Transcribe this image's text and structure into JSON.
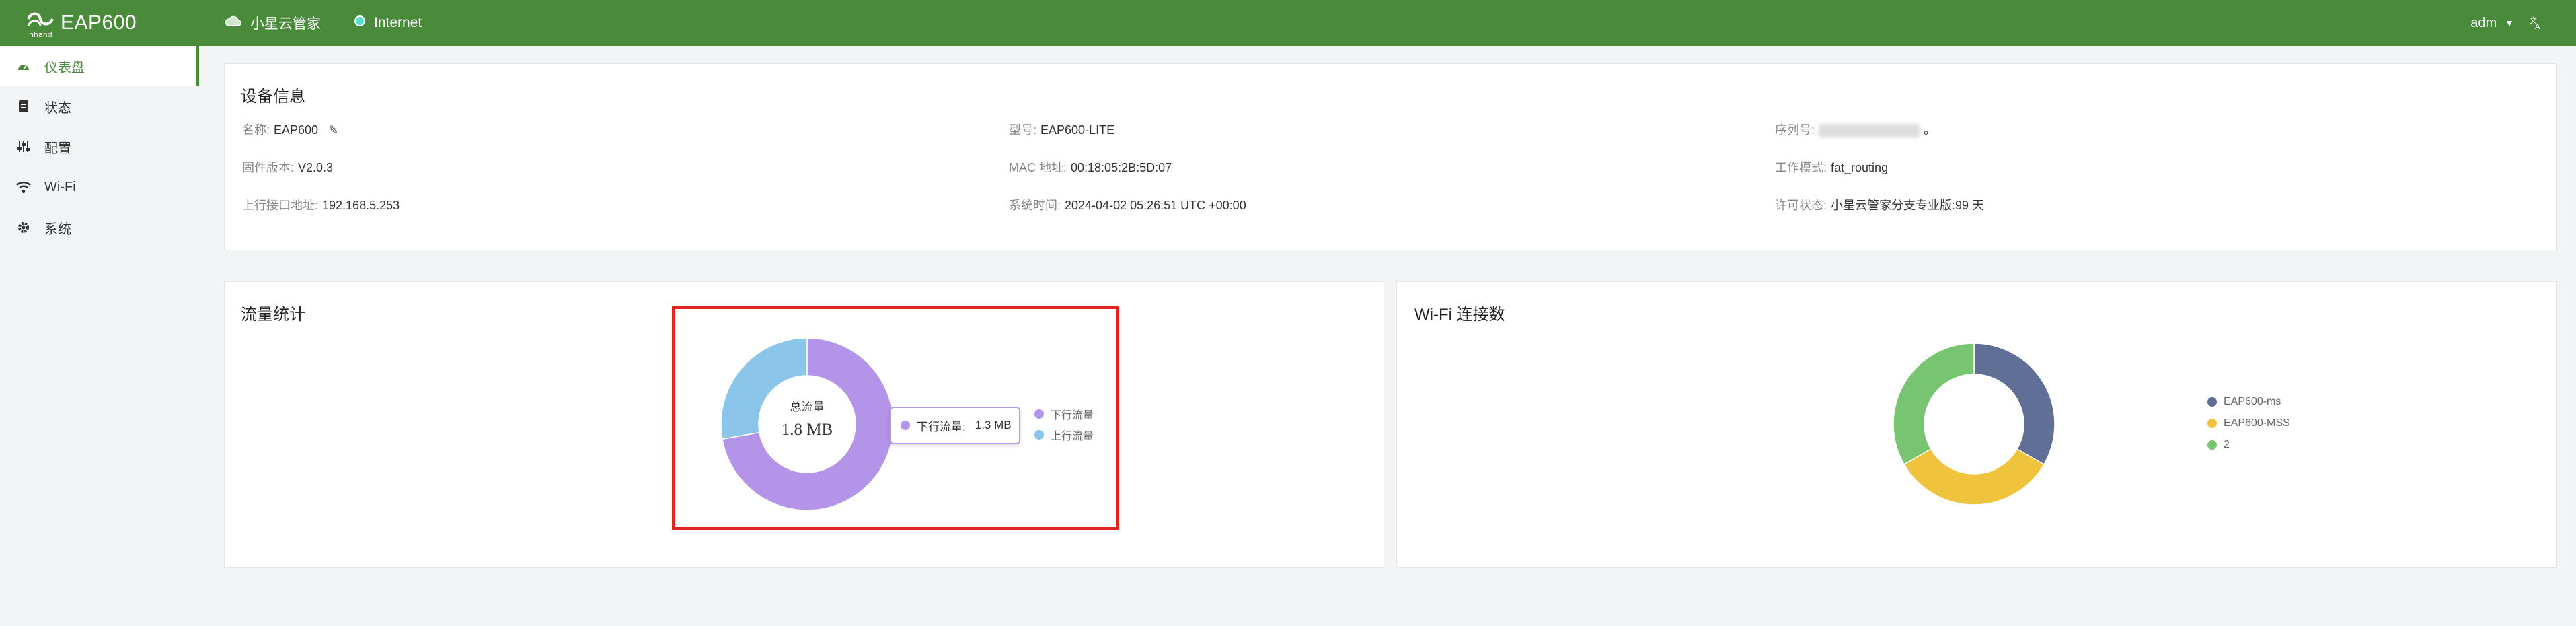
{
  "app": {
    "logo_sub": "inhand",
    "title": "EAP600"
  },
  "topbar": {
    "cloud_label": "小星云管家",
    "internet_label": "Internet",
    "user": "adm"
  },
  "sidebar": {
    "items": [
      {
        "label": "仪表盘",
        "icon": "dashboard-icon",
        "active": true
      },
      {
        "label": "状态",
        "icon": "status-icon"
      },
      {
        "label": "配置",
        "icon": "config-icon"
      },
      {
        "label": "Wi-Fi",
        "icon": "wifi-icon"
      },
      {
        "label": "系统",
        "icon": "gear-icon"
      }
    ]
  },
  "device": {
    "title": "设备信息",
    "name_label": "名称:",
    "name": "EAP600",
    "fw_label": "固件版本:",
    "fw": "V2.0.3",
    "uplink_label": "上行接口地址:",
    "uplink": "192.168.5.253",
    "model_label": "型号:",
    "model": "EAP600-LITE",
    "mac_label": "MAC 地址:",
    "mac": "00:18:05:2B:5D:07",
    "time_label": "系统时间:",
    "time": "2024-04-02 05:26:51 UTC +00:00",
    "serial_label": "序列号:",
    "serial_suffix": "。",
    "mode_label": "工作模式:",
    "mode": "fat_routing",
    "license_label": "许可状态:",
    "license": "小星云管家分支专业版:99 天"
  },
  "traffic": {
    "title": "流量统计",
    "center_title": "总流量",
    "center_value": "1.8 MB",
    "tooltip_label": "下行流量:",
    "tooltip_value": "1.3 MB",
    "chart_data": {
      "type": "pie",
      "labels": [
        "下行流量",
        "上行流量"
      ],
      "values": [
        1.3,
        0.5
      ],
      "unit": "MB",
      "colors": [
        "#b394e8",
        "#8cc5ea"
      ],
      "legend_position": "right"
    }
  },
  "wifi": {
    "title": "Wi-Fi 连接数",
    "chart_data": {
      "type": "pie",
      "labels": [
        "EAP600-ms",
        "EAP600-MSS",
        "2"
      ],
      "values": [
        1,
        1,
        1
      ],
      "colors": [
        "#5f6f95",
        "#f0c33c",
        "#77c471"
      ],
      "legend_position": "right"
    }
  },
  "colors": {
    "brand": "#4a8b3b",
    "highlight": "#e42222"
  }
}
